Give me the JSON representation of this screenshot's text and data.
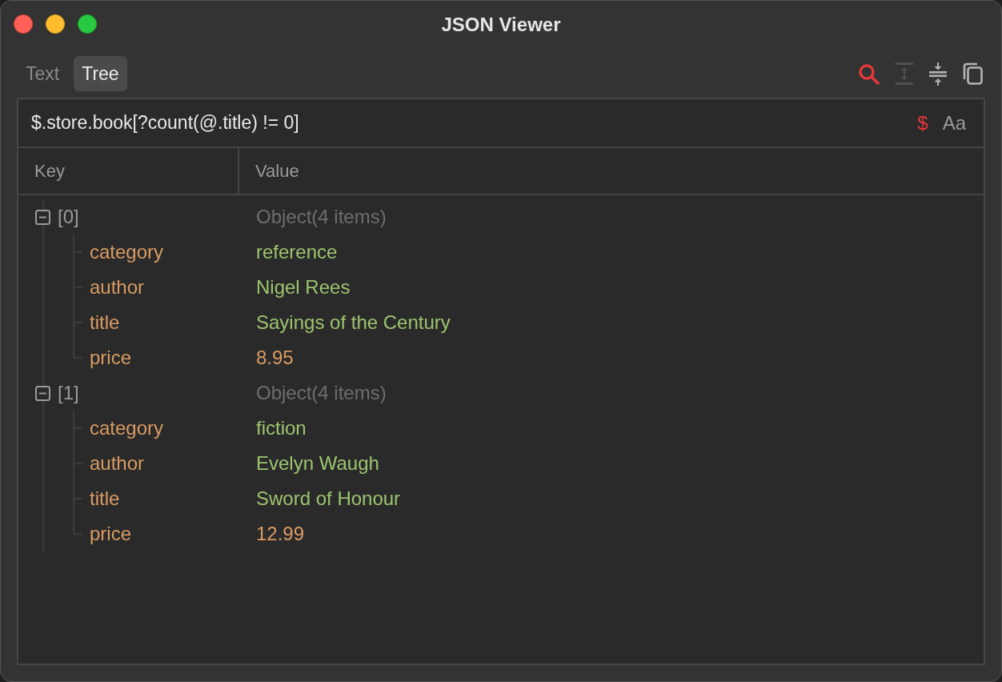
{
  "window": {
    "title": "JSON Viewer"
  },
  "tabs": [
    {
      "label": "Text",
      "selected": false
    },
    {
      "label": "Tree",
      "selected": true
    }
  ],
  "toolbar": [
    {
      "kind": "search",
      "on": true,
      "disabled": false
    },
    {
      "kind": "expand",
      "on": false,
      "disabled": true
    },
    {
      "kind": "collapse",
      "on": false,
      "disabled": false
    },
    {
      "kind": "copy",
      "on": false,
      "disabled": false
    }
  ],
  "query": {
    "value": "$.store.book[?count(@.title) != 0]",
    "options": [
      {
        "label": "$",
        "selected": true
      },
      {
        "label": "Aa",
        "selected": false
      }
    ]
  },
  "columns": [
    "Key",
    "Value"
  ],
  "tree": [
    {
      "key": "[0]",
      "value": "Object(4 items)",
      "expanded": true,
      "children": [
        {
          "key": "category",
          "value": "reference",
          "kind": "string"
        },
        {
          "key": "author",
          "value": "Nigel Rees",
          "kind": "string"
        },
        {
          "key": "title",
          "value": "Sayings of the Century",
          "kind": "string"
        },
        {
          "key": "price",
          "value": "8.95",
          "kind": "number"
        }
      ]
    },
    {
      "key": "[1]",
      "value": "Object(4 items)",
      "expanded": true,
      "children": [
        {
          "key": "category",
          "value": "fiction",
          "kind": "string"
        },
        {
          "key": "author",
          "value": "Evelyn Waugh",
          "kind": "string"
        },
        {
          "key": "title",
          "value": "Sword of Honour",
          "kind": "string"
        },
        {
          "key": "price",
          "value": "12.99",
          "kind": "number"
        }
      ]
    }
  ]
}
